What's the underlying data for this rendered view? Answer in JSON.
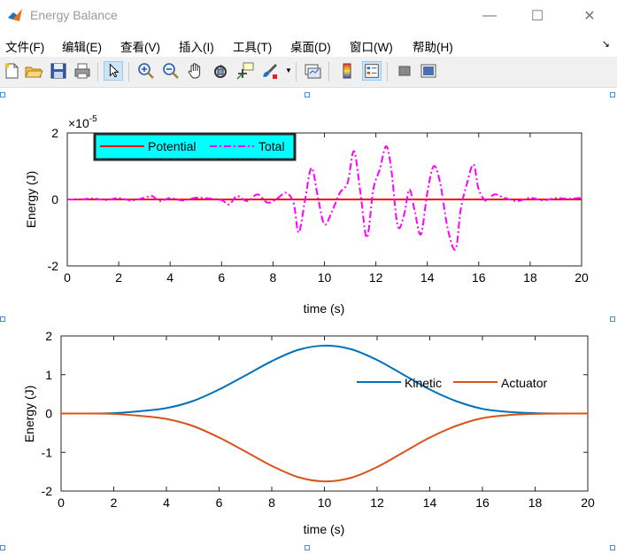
{
  "window": {
    "title": "Energy Balance",
    "controls": {
      "minimize": "—",
      "maximize": "☐",
      "close": "✕"
    }
  },
  "menu": {
    "items": [
      "文件(F)",
      "编辑(E)",
      "查看(V)",
      "插入(I)",
      "工具(T)",
      "桌面(D)",
      "窗口(W)",
      "帮助(H)"
    ],
    "arrow": "↘"
  },
  "toolbar": {
    "buttons": [
      "new-figure-icon",
      "open-folder-icon",
      "save-icon",
      "print-icon",
      "pointer-icon",
      "zoom-in-icon",
      "zoom-out-icon",
      "pan-hand-icon",
      "rotate-3d-icon",
      "data-cursor-icon",
      "brush-icon",
      "link-plot-icon",
      "colorbar-icon",
      "legend-icon",
      "hide-plot-tools-icon",
      "show-plot-tools-icon"
    ],
    "active": "pointer-icon"
  },
  "chart_data": [
    {
      "type": "line",
      "xlabel": "time (s)",
      "ylabel": "Energy (J)",
      "xlim": [
        0,
        20
      ],
      "ylim": [
        -2,
        2
      ],
      "yscale_exponent": "×10",
      "yscale_power": "-5",
      "xticks": [
        "0",
        "2",
        "4",
        "6",
        "8",
        "10",
        "12",
        "14",
        "16",
        "18",
        "20"
      ],
      "yticks": [
        "2",
        "0",
        "-2"
      ],
      "legend": {
        "placement": "top-left",
        "entries": [
          "Potential",
          "Total"
        ],
        "background": "#00ffff"
      },
      "series": [
        {
          "name": "Potential",
          "color": "#ff0000",
          "style": "solid",
          "x": [
            0,
            20
          ],
          "y": [
            0,
            0
          ]
        },
        {
          "name": "Total",
          "color": "#ff00ff",
          "style": "dashdot",
          "x": [
            0,
            0.5,
            1,
            1.5,
            2,
            2.5,
            3,
            3.3,
            3.6,
            4,
            4.5,
            5,
            5.5,
            6,
            6.3,
            6.6,
            7,
            7.4,
            7.8,
            8.2,
            8.5,
            8.8,
            9.0,
            9.25,
            9.5,
            9.75,
            10.0,
            10.3,
            10.6,
            10.9,
            11.15,
            11.4,
            11.65,
            11.9,
            12.15,
            12.4,
            12.6,
            12.85,
            13.1,
            13.3,
            13.5,
            13.75,
            14.0,
            14.25,
            14.5,
            14.8,
            15.1,
            15.3,
            15.55,
            15.8,
            16.0,
            16.3,
            16.6,
            17.0,
            17.5,
            18,
            18.5,
            19,
            19.5,
            20
          ],
          "y": [
            0,
            0,
            0.03,
            -0.02,
            0.04,
            -0.03,
            0.05,
            0.1,
            -0.05,
            0.04,
            -0.03,
            0.05,
            0.03,
            -0.02,
            -0.15,
            0.1,
            -0.05,
            0.15,
            -0.1,
            0.05,
            0.2,
            -0.1,
            -1.0,
            0.0,
            0.95,
            0.05,
            -0.75,
            -0.35,
            0.2,
            0.5,
            1.45,
            0.2,
            -1.15,
            0.3,
            0.9,
            1.6,
            0.9,
            -0.8,
            -0.45,
            0.3,
            -0.3,
            -1.05,
            0.2,
            1.0,
            0.5,
            -0.9,
            -1.5,
            -0.3,
            0.5,
            1.05,
            0.3,
            -0.05,
            0.15,
            0.05,
            -0.05,
            0.05,
            -0.03,
            0.04,
            0.02,
            0.05
          ]
        }
      ]
    },
    {
      "type": "line",
      "xlabel": "time (s)",
      "ylabel": "Energy (J)",
      "xlim": [
        0,
        20
      ],
      "ylim": [
        -2,
        2
      ],
      "xticks": [
        "0",
        "2",
        "4",
        "6",
        "8",
        "10",
        "12",
        "14",
        "16",
        "18",
        "20"
      ],
      "yticks": [
        "2",
        "1",
        "0",
        "-1",
        "-2"
      ],
      "legend": {
        "placement": "top-right",
        "entries": [
          "Kinetic",
          "Actuator"
        ]
      },
      "series": [
        {
          "name": "Kinetic",
          "color": "#0072bd",
          "style": "solid",
          "x": [
            0,
            1,
            2,
            3,
            4,
            5,
            6,
            7,
            8,
            9,
            10,
            11,
            12,
            13,
            14,
            15,
            16,
            17,
            18,
            19,
            20
          ],
          "y": [
            0,
            0,
            0.01,
            0.06,
            0.14,
            0.32,
            0.62,
            0.98,
            1.35,
            1.64,
            1.75,
            1.66,
            1.38,
            1.0,
            0.62,
            0.32,
            0.12,
            0.04,
            0.01,
            0,
            0
          ]
        },
        {
          "name": "Actuator",
          "color": "#d95319",
          "style": "solid",
          "x": [
            0,
            1,
            2,
            3,
            4,
            5,
            6,
            7,
            8,
            9,
            10,
            11,
            12,
            13,
            14,
            15,
            16,
            17,
            18,
            19,
            20
          ],
          "y": [
            0,
            0,
            -0.01,
            -0.06,
            -0.14,
            -0.32,
            -0.62,
            -0.98,
            -1.35,
            -1.64,
            -1.75,
            -1.66,
            -1.38,
            -1.0,
            -0.62,
            -0.32,
            -0.12,
            -0.04,
            -0.01,
            0,
            0
          ]
        }
      ]
    }
  ]
}
